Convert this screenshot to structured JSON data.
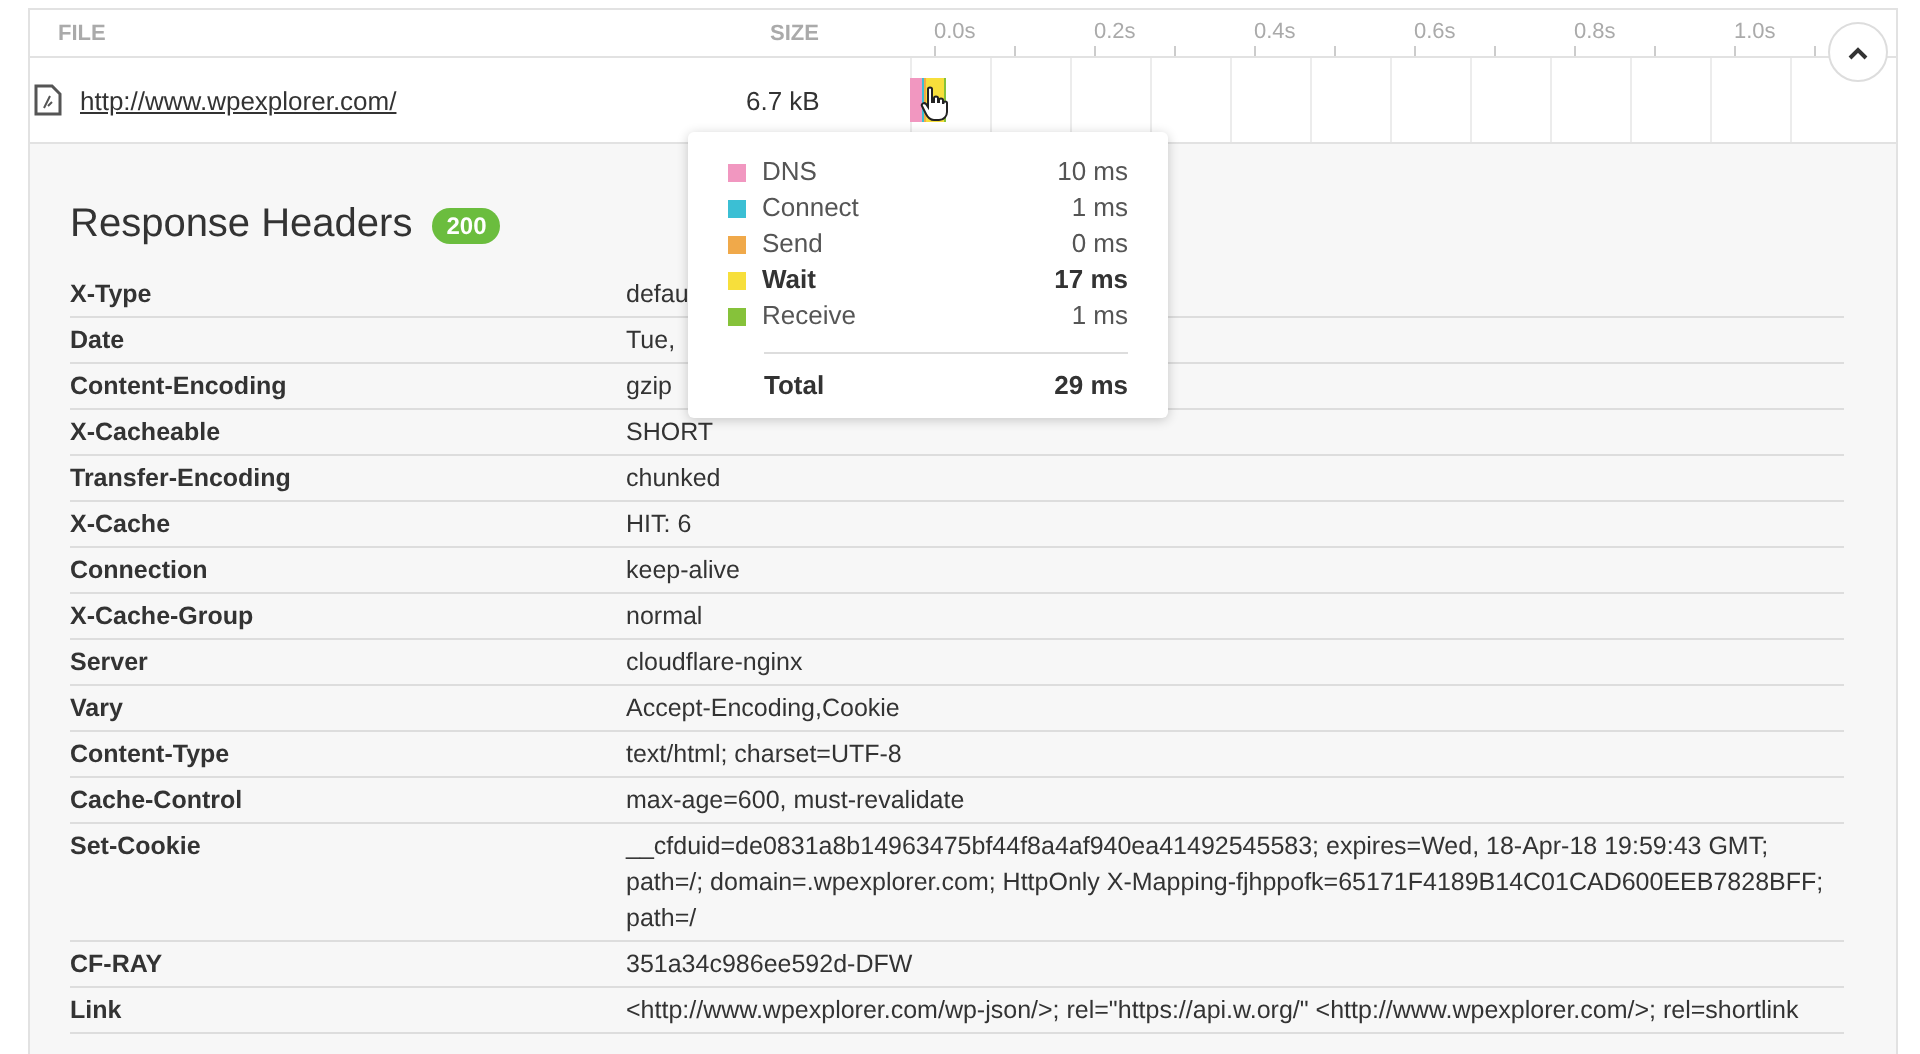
{
  "columns": {
    "file": "FILE",
    "size": "SIZE"
  },
  "timeline": {
    "ticks": [
      "0.0s",
      "0.2s",
      "0.4s",
      "0.6s",
      "0.8s",
      "1.0s"
    ]
  },
  "request": {
    "url": "http://www.wpexplorer.com/",
    "size": "6.7 kB",
    "expanded": true
  },
  "tooltip": {
    "phases": [
      {
        "label": "DNS",
        "value": "10 ms",
        "color": "#f197c0",
        "highlighted": false
      },
      {
        "label": "Connect",
        "value": "1 ms",
        "color": "#3bbfd4",
        "highlighted": false
      },
      {
        "label": "Send",
        "value": "0 ms",
        "color": "#f0a94a",
        "highlighted": false
      },
      {
        "label": "Wait",
        "value": "17 ms",
        "color": "#f7df3b",
        "highlighted": true
      },
      {
        "label": "Receive",
        "value": "1 ms",
        "color": "#86c23a",
        "highlighted": false
      }
    ],
    "total_label": "Total",
    "total_value": "29 ms"
  },
  "headers": {
    "title": "Response Headers",
    "status": "200",
    "rows": [
      {
        "name": "X-Type",
        "value": "defau"
      },
      {
        "name": "Date",
        "value": "Tue,"
      },
      {
        "name": "Content-Encoding",
        "value": "gzip"
      },
      {
        "name": "X-Cacheable",
        "value": "SHORT"
      },
      {
        "name": "Transfer-Encoding",
        "value": "chunked"
      },
      {
        "name": "X-Cache",
        "value": "HIT: 6"
      },
      {
        "name": "Connection",
        "value": "keep-alive"
      },
      {
        "name": "X-Cache-Group",
        "value": "normal"
      },
      {
        "name": "Server",
        "value": "cloudflare-nginx"
      },
      {
        "name": "Vary",
        "value": "Accept-Encoding,Cookie"
      },
      {
        "name": "Content-Type",
        "value": "text/html; charset=UTF-8"
      },
      {
        "name": "Cache-Control",
        "value": "max-age=600, must-revalidate"
      },
      {
        "name": "Set-Cookie",
        "value": "__cfduid=de0831a8b14963475bf44f8a4af940ea41492545583; expires=Wed, 18-Apr-18 19:59:43 GMT; path=/; domain=.wpexplorer.com; HttpOnly X-Mapping-fjhppofk=65171F4189B14C01CAD600EEB7828BFF; path=/"
      },
      {
        "name": "CF-RAY",
        "value": "351a34c986ee592d-DFW"
      },
      {
        "name": "Link",
        "value": "<http://www.wpexplorer.com/wp-json/>; rel=\"https://api.w.org/\" <http://www.wpexplorer.com/>; rel=shortlink"
      }
    ]
  }
}
